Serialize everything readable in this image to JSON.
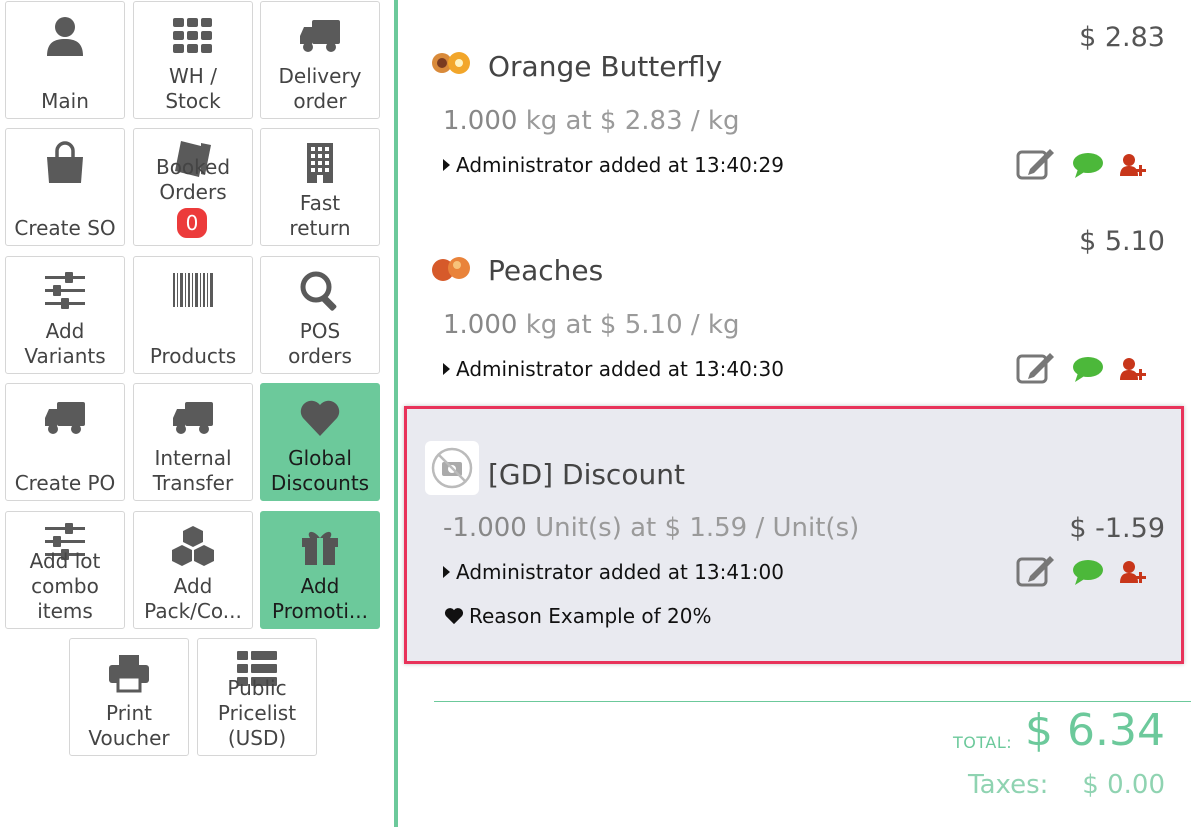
{
  "buttons": {
    "main": "Main",
    "wh_stock": "WH /\nStock",
    "delivery": "Delivery\norder",
    "create_so": "Create SO",
    "booked": "Booked\nOrders",
    "booked_count": "0",
    "fast_return": "Fast\nreturn",
    "add_variants": "Add\nVariants",
    "products": "Products",
    "pos_orders": "POS\norders",
    "create_po": "Create PO",
    "internal_transfer": "Internal\nTransfer",
    "global_discounts": "Global\nDiscounts",
    "add_lot_combo": "Add lot\ncombo\nitems",
    "add_pack": "Add\nPack/Co...",
    "add_promotion": "Add\nPromoti...",
    "print_voucher": "Print\nVoucher",
    "public_pricelist": "Public\nPricelist\n(USD)"
  },
  "colors": {
    "accent": "#6cc99b",
    "selection": "#e8335a",
    "badge": "#ec3b3b"
  },
  "order": {
    "lines": [
      {
        "name": "Orange Butterfly",
        "price": "$ 2.83",
        "qty": "1.000",
        "qty_rest": " kg at $ 2.83 / kg",
        "added": "Administrator added at 13:40:29"
      },
      {
        "name": "Peaches",
        "price": "$ 5.10",
        "qty": "1.000",
        "qty_rest": " kg at $ 5.10 / kg",
        "added": "Administrator added at 13:40:30"
      },
      {
        "name": "[GD] Discount",
        "price": "$ -1.59",
        "qty": "-1.000",
        "qty_rest": " Unit(s) at $ 1.59 / Unit(s)",
        "added": "Administrator added at 13:41:00",
        "reason": "Reason Example of 20%"
      }
    ],
    "total_label": "TOTAL:",
    "total_value": "$ 6.34",
    "taxes_label": "Taxes:",
    "taxes_value": "$ 0.00"
  }
}
